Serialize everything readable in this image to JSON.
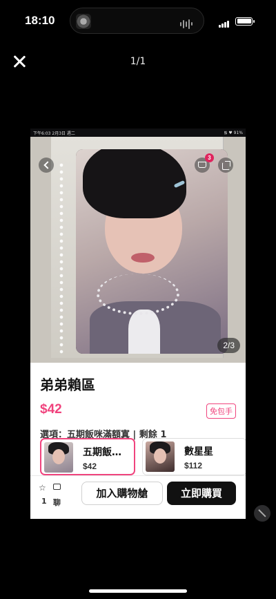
{
  "status_bar": {
    "time": "18:10"
  },
  "viewer": {
    "counter": "1/1"
  },
  "embedded": {
    "status": {
      "time": "下午6:03 2月3日 週二",
      "right": "᯾ ♥ 91%"
    },
    "photo": {
      "counter": "2/3",
      "cart_badge": "3"
    },
    "product": {
      "title": "弟弟賴區",
      "price": "$42",
      "shipping_tag": "免包手",
      "option_text": "選項：五期飯咪滿額寘 | 剩餘 1"
    },
    "variants": [
      {
        "name": "五期飯…",
        "price": "$42",
        "selected": true
      },
      {
        "name": "數星星",
        "price": "$112",
        "selected": false
      }
    ],
    "actions": {
      "like_count": "1",
      "chat_label": "聊",
      "add_to_cart": "加入購物艙",
      "buy_now": "立即購買"
    },
    "colors": {
      "accent": "#f0437d",
      "buy_button": "#111111"
    }
  }
}
